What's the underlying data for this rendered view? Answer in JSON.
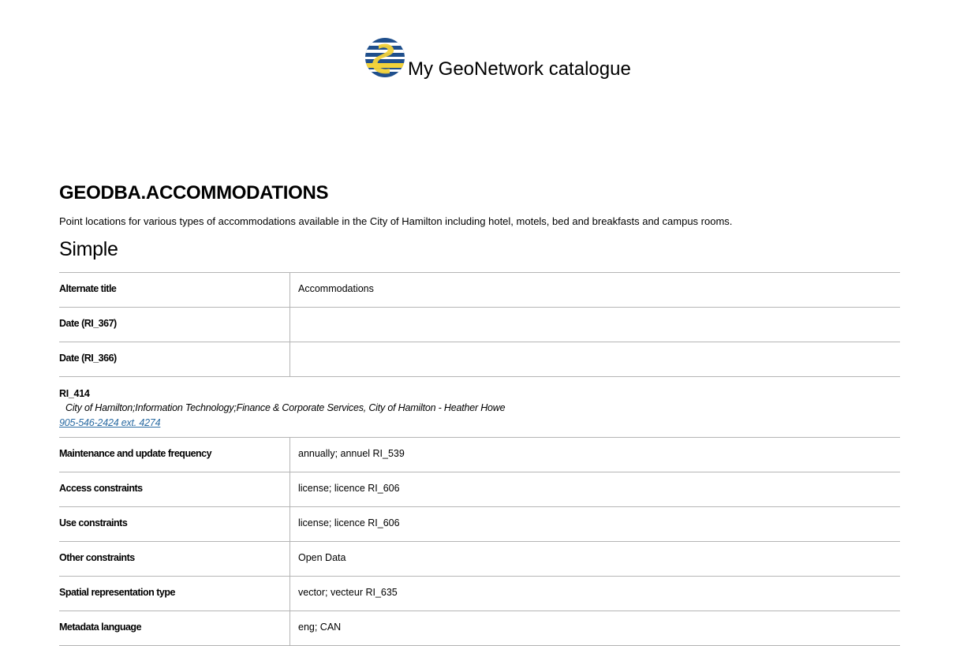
{
  "header": {
    "catalogue_title": "My GeoNetwork catalogue"
  },
  "record": {
    "title": "GEODBA.ACCOMMODATIONS",
    "abstract": "Point locations for various types of accommodations available in the City of Hamilton including hotel, motels, bed and breakfasts and campus rooms.",
    "section_title": "Simple"
  },
  "rows_top": [
    {
      "label": "Alternate title",
      "value": "Accommodations"
    },
    {
      "label": "Date (RI_367)",
      "value": ""
    },
    {
      "label": "Date (RI_366)",
      "value": ""
    }
  ],
  "contact": {
    "title": "RI_414",
    "organisation": "City of Hamilton;Information Technology;Finance & Corporate Services, City of Hamilton - Heather Howe",
    "phone": "905-546-2424 ext. 4274"
  },
  "rows_bottom": [
    {
      "label": "Maintenance and update frequency",
      "value": "annually; annuel RI_539"
    },
    {
      "label": "Access constraints",
      "value": "license; licence RI_606"
    },
    {
      "label": "Use constraints",
      "value": "license; licence RI_606"
    },
    {
      "label": "Other constraints",
      "value": "Open Data"
    },
    {
      "label": "Spatial representation type",
      "value": "vector; vecteur RI_635"
    },
    {
      "label": "Metadata language",
      "value": "eng; CAN"
    }
  ],
  "colors": {
    "logo_blue": "#1f4f8c",
    "logo_yellow": "#f2d23a",
    "link": "#2b6ca3",
    "rule": "#b5b5b5"
  }
}
